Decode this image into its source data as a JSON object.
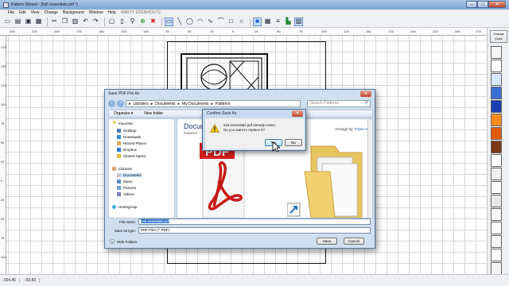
{
  "window": {
    "title": "Pattern Wizard - [5x5 essentials.pdf *]",
    "min": "–",
    "max": "□",
    "close": "✕"
  },
  "menu": {
    "items": [
      "File",
      "Edit",
      "View",
      "Change",
      "Background",
      "Window",
      "Help"
    ],
    "extra": "MARTY EDENHOUTS"
  },
  "ruler_h": [
    "250",
    "225",
    "200",
    "175",
    "150",
    "125",
    "100",
    "75",
    "50",
    "25",
    "0",
    "25",
    "50",
    "75",
    "100",
    "125",
    "150",
    "175",
    "200",
    "225",
    "250",
    "275"
  ],
  "ruler_v": [
    "175",
    "150",
    "125",
    "100",
    "75",
    "50",
    "25",
    "0",
    "25",
    "50",
    "75",
    "100",
    "125"
  ],
  "palette": {
    "change_color": "Change Color",
    "swatches": [
      "#f4f4f4",
      "#ffffff",
      "#d8e8ff",
      "#3b6fd6",
      "#1a3fb0",
      "#ff8a1a",
      "#e05a00",
      "#7a3a1a",
      "#ffffff",
      "#f0f0f0",
      "#ffffff",
      "#e8e8e8",
      "#f6f6f6",
      "#ffffff",
      "#f4f4f4",
      "#ffffff",
      "#f2f2f2"
    ]
  },
  "status": {
    "x": "-154.45",
    "y": "-93.83"
  },
  "save_dialog": {
    "title": "Save PDF File As",
    "close": "✕",
    "breadcrumb": [
      "Libraries",
      "Documents",
      "My Documents",
      "Patterns"
    ],
    "search_placeholder": "Search Patterns",
    "organize": "Organize ▾",
    "new_folder": "New folder",
    "nav": {
      "favorites": "Favorites",
      "desktop": "Desktop",
      "downloads": "Downloads",
      "recent": "Recent Places",
      "dropbox": "Dropbox",
      "shared": "Shared Space",
      "libraries": "Libraries",
      "documents": "Documents",
      "music": "Music",
      "pictures": "Pictures",
      "videos": "Videos",
      "homegroup": "Homegroup"
    },
    "library_title": "Documents library",
    "library_sub": "Patterns",
    "arrange_label": "Arrange by:",
    "arrange_value": "Folder ▾",
    "pdf_label": "PDF",
    "file_name_label": "File name:",
    "file_name_value": "5x5 essentials.pdf",
    "save_type_label": "Save as type:",
    "save_type_value": "PDF Files (*.PDF)",
    "hide_folders": "Hide Folders",
    "save_button": "Save",
    "cancel_button": "Cancel"
  },
  "confirm_dialog": {
    "title": "Confirm Save As",
    "close": "✕",
    "line1": "5x5 essentials.pdf already exists.",
    "line2": "Do you want to replace it?",
    "yes": "Yes",
    "no": "No"
  }
}
